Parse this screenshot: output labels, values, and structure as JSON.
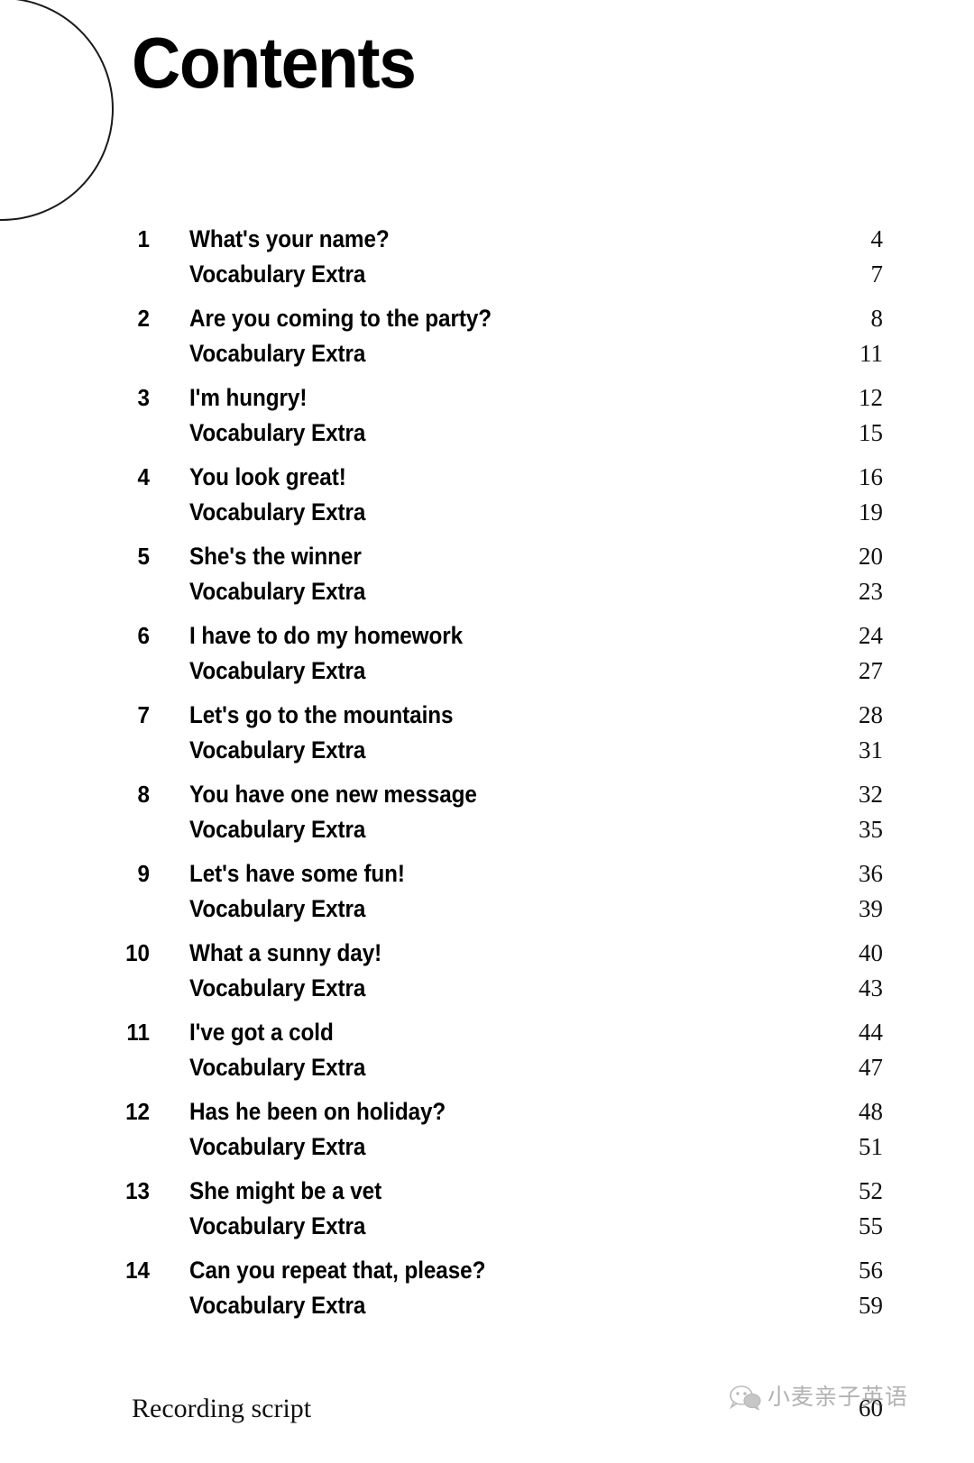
{
  "document": {
    "title": "Contents",
    "decoration": "circle-arc"
  },
  "toc": {
    "sub_entry_label": "Vocabulary Extra",
    "units": [
      {
        "number": "1",
        "title": "What's your name?",
        "page": "4",
        "sub_label": "Vocabulary Extra",
        "sub_page": "7"
      },
      {
        "number": "2",
        "title": "Are you coming to the party?",
        "page": "8",
        "sub_label": "Vocabulary Extra",
        "sub_page": "11"
      },
      {
        "number": "3",
        "title": "I'm hungry!",
        "page": "12",
        "sub_label": "Vocabulary Extra",
        "sub_page": "15"
      },
      {
        "number": "4",
        "title": "You look great!",
        "page": "16",
        "sub_label": "Vocabulary Extra",
        "sub_page": "19"
      },
      {
        "number": "5",
        "title": "She's the winner",
        "page": "20",
        "sub_label": "Vocabulary Extra",
        "sub_page": "23"
      },
      {
        "number": "6",
        "title": "I have to do my homework",
        "page": "24",
        "sub_label": "Vocabulary Extra",
        "sub_page": "27"
      },
      {
        "number": "7",
        "title": "Let's go to the mountains",
        "page": "28",
        "sub_label": "Vocabulary Extra",
        "sub_page": "31"
      },
      {
        "number": "8",
        "title": "You have one new message",
        "page": "32",
        "sub_label": "Vocabulary Extra",
        "sub_page": "35"
      },
      {
        "number": "9",
        "title": "Let's have some fun!",
        "page": "36",
        "sub_label": "Vocabulary Extra",
        "sub_page": "39"
      },
      {
        "number": "10",
        "title": "What a sunny day!",
        "page": "40",
        "sub_label": "Vocabulary Extra",
        "sub_page": "43"
      },
      {
        "number": "11",
        "title": "I've got a cold",
        "page": "44",
        "sub_label": "Vocabulary Extra",
        "sub_page": "47"
      },
      {
        "number": "12",
        "title": "Has he been on holiday?",
        "page": "48",
        "sub_label": "Vocabulary Extra",
        "sub_page": "51"
      },
      {
        "number": "13",
        "title": "She might be a vet",
        "page": "52",
        "sub_label": "Vocabulary Extra",
        "sub_page": "55"
      },
      {
        "number": "14",
        "title": "Can you repeat that, please?",
        "page": "56",
        "sub_label": "Vocabulary Extra",
        "sub_page": "59"
      }
    ]
  },
  "footer": {
    "label": "Recording script",
    "page": "60"
  },
  "watermark": {
    "text": "小麦亲子英语",
    "logo": "wechat-icon"
  },
  "colors": {
    "background": "#ffffff",
    "text": "#111111",
    "heading": "#000000",
    "watermark": "#4a4a4a"
  }
}
